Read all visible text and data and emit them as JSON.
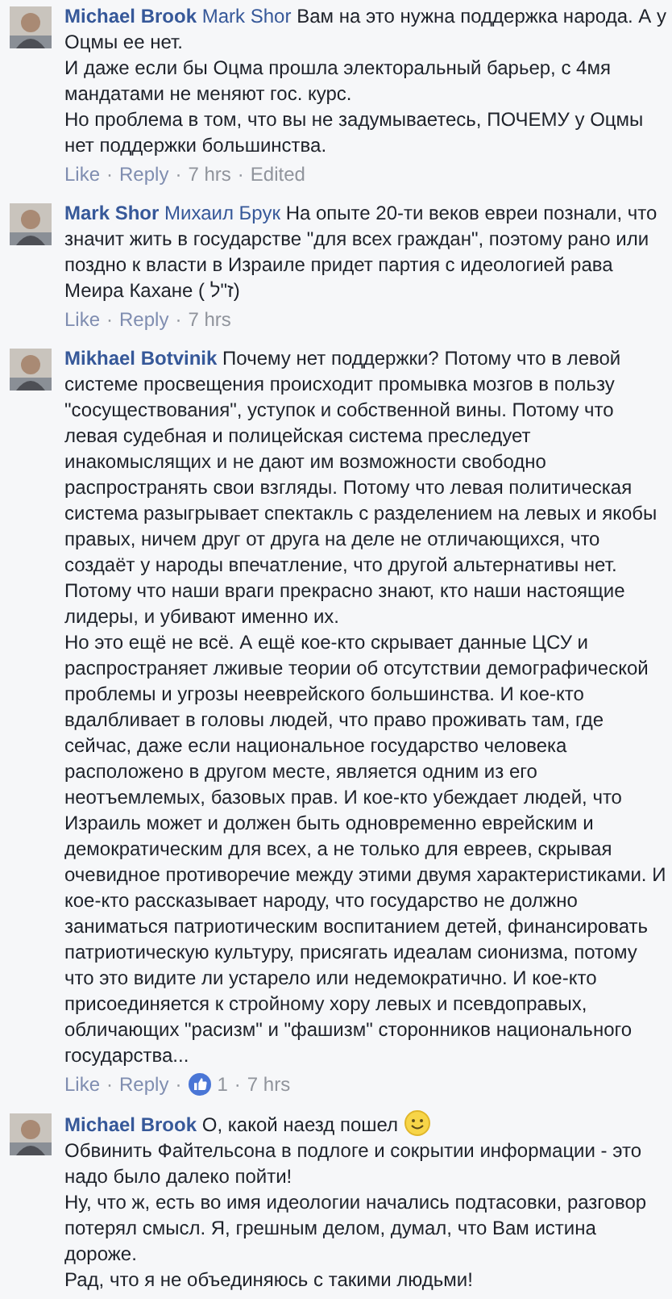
{
  "separator": "·",
  "comments": [
    {
      "author": "Michael Brook",
      "mention": "Mark Shor",
      "paragraphs": [
        "Вам на это нужна поддержка народа. А у Оцмы ее нет.",
        "И даже если бы Оцма прошла электоральный барьер, с 4мя мандатами не меняют гос. курс.",
        "Но проблема в том, что вы не задумываетесь, ПОЧЕМУ у Оцмы нет поддержки большинства."
      ],
      "trailing_emoji": false,
      "like": "Like",
      "reply": "Reply",
      "time": "7 hrs",
      "edited": "Edited"
    },
    {
      "author": "Mark Shor",
      "mention": "Михаил Брук",
      "paragraphs": [
        "На опыте 20-ти веков евреи познали, что значит жить в государстве \"для всех граждан\", поэтому рано или поздно к власти в Израиле придет партия с идеологией рава Меира Кахане ( ז\"ל)"
      ],
      "trailing_emoji": false,
      "like": "Like",
      "reply": "Reply",
      "time": "7 hrs"
    },
    {
      "author": "Mikhael Botvinik",
      "paragraphs": [
        "Почему нет поддержки? Потому что в левой системе просвещения происходит промывка мозгов в пользу \"сосуществования\", уступок и собственной вины. Потому что левая судебная и полицейская система преследует инакомыслящих и не дают им возможности свободно распространять свои взгляды. Потому что левая политическая система разыгрывает спектакль с разделением на левых и якобы правых, ничем друг от друга на деле не отличающихся, что создаёт у народы впечатление, что другой альтернативы нет. Потому что наши враги прекрасно знают, кто наши настоящие лидеры, и убивают именно их.",
        "Но это ещё не всё. А ещё кое-кто скрывает данные ЦСУ и распространяет лживые теории об отсутствии демографической проблемы и угрозы нееврейского большинства. И кое-кто вдалбливает в головы людей, что право проживать там, где сейчас, даже если национальное государство человека расположено в другом месте, является одним из его неотъемлемых, базовых прав. И кое-кто убеждает людей, что Израиль может и должен быть одновременно еврейским и демократическим для всех, а не только для евреев, скрывая очевидное противоречие между этими двумя характеристиками. И кое-кто рассказывает народу, что государство не должно заниматься патриотическим воспитанием детей, финансировать патриотическую культуру, присягать идеалам сионизма, потому что это видите ли устарело или недемократично. И кое-кто присоединяется к стройному хору левых и псевдоправых, обличающих \"расизм\" и \"фашизм\" сторонников национального государства..."
      ],
      "trailing_emoji": false,
      "like": "Like",
      "reply": "Reply",
      "reaction_count": "1",
      "time": "7 hrs"
    },
    {
      "author": "Michael Brook",
      "paragraphs": [
        "О, какой наезд пошел",
        "Обвинить Файтельсона в подлоге и сокрытии информации - это надо было далеко пойти!",
        "Ну, что ж, есть во имя идеологии начались подтасовки, разговор потерял смысл. Я, грешным делом, думал, что Вам истина дороже.",
        "Рад, что я не объединяюсь с такими людьми!"
      ],
      "trailing_emoji": true
    }
  ]
}
